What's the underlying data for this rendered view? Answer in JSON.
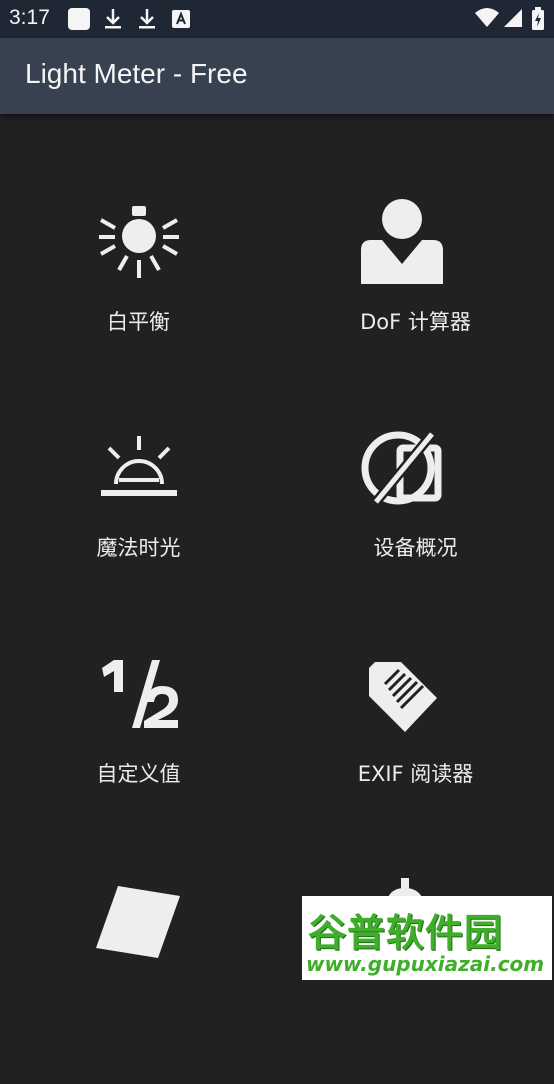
{
  "status_bar": {
    "time": "3:17"
  },
  "app_bar": {
    "title": "Light Meter - Free"
  },
  "menu": {
    "items": [
      {
        "label": "白平衡",
        "icon": "lightbulb-icon"
      },
      {
        "label": "DoF 计算器",
        "icon": "person-icon"
      },
      {
        "label": "魔法时光",
        "icon": "sunrise-icon"
      },
      {
        "label": "设备概况",
        "icon": "device-profile-icon"
      },
      {
        "label": "自定义值",
        "icon": "one-half-icon"
      },
      {
        "label": "EXIF 阅读器",
        "icon": "tag-icon"
      },
      {
        "label": "",
        "icon": "card-icon"
      },
      {
        "label": "",
        "icon": "dollar-icon"
      }
    ]
  },
  "watermark": {
    "main": "谷普软件园",
    "sub": "www.gupuxiazai.com"
  },
  "colors": {
    "background": "#212121",
    "app_bar": "#37414f",
    "status_bar": "#1e2733",
    "icon": "#eeeeee",
    "watermark_green": "#3fae2a"
  }
}
